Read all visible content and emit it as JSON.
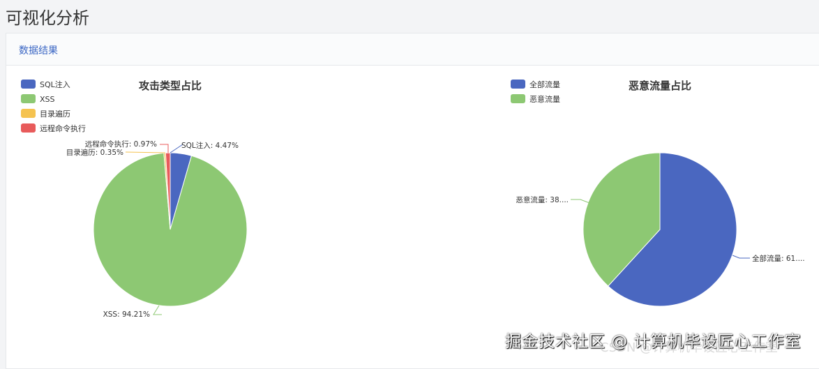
{
  "page_title": "可视化分析",
  "card_title": "数据结果",
  "watermark": "掘金技术社区 @ 计算机毕设匠心工作室",
  "watermark2": "CSDN @计算机毕设匠心工作室",
  "chart_data": [
    {
      "type": "pie",
      "title": "攻击类型占比",
      "legend_position": "top-left",
      "categories": [
        "SQL注入",
        "XSS",
        "目录遍历",
        "远程命令执行"
      ],
      "values": [
        4.47,
        94.21,
        0.35,
        0.97
      ],
      "labels": [
        "SQL注入: 4.47%",
        "XSS: 94.21%",
        "目录遍历: 0.35%",
        "远程命令执行: 0.97%"
      ],
      "colors": [
        "#4a67c0",
        "#8dc873",
        "#f5c350",
        "#e85b5b"
      ]
    },
    {
      "type": "pie",
      "title": "恶意流量占比",
      "legend_position": "top-left",
      "categories": [
        "全部流量",
        "恶意流量"
      ],
      "values": [
        61.8,
        38.2
      ],
      "labels": [
        "全部流量: 61....",
        "恶意流量: 38...."
      ],
      "colors": [
        "#4a67c0",
        "#8dc873"
      ]
    }
  ]
}
